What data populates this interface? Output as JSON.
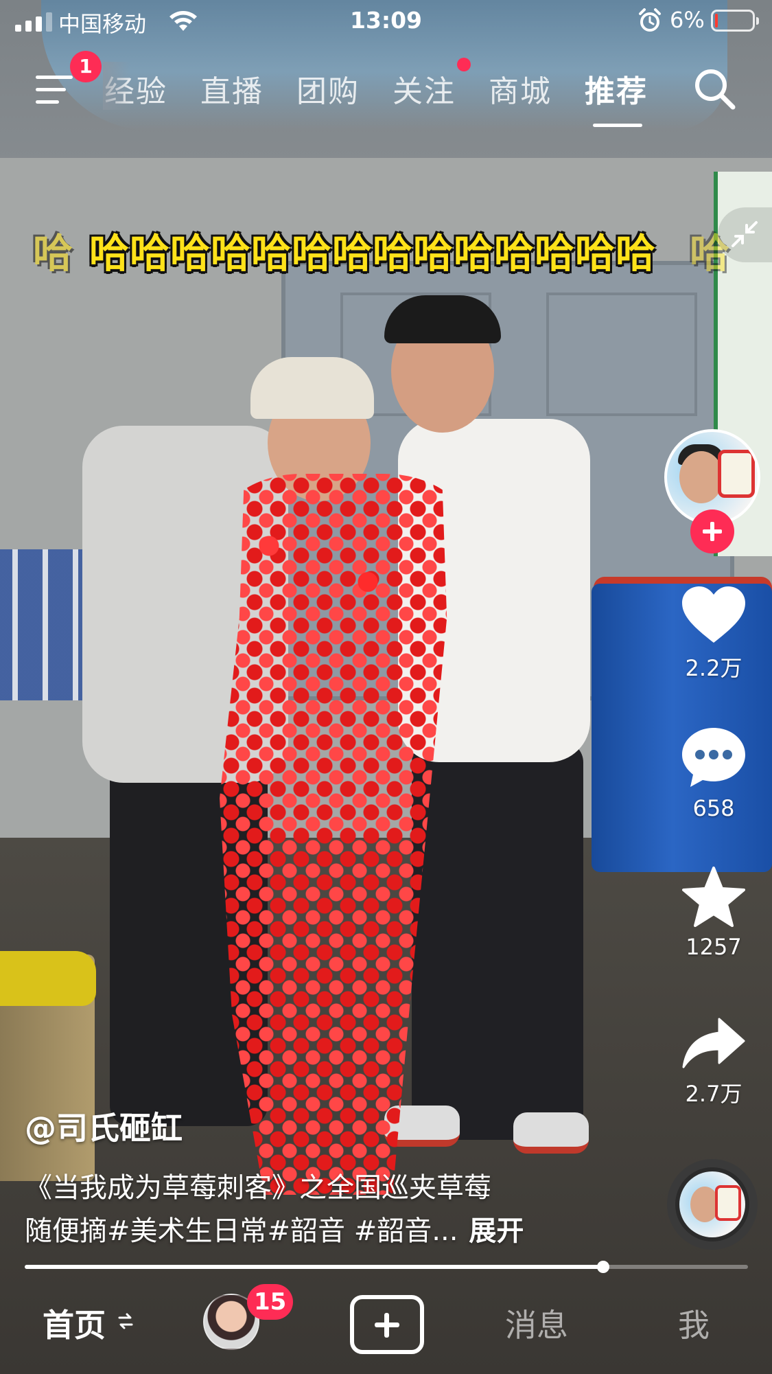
{
  "status_bar": {
    "carrier": "中国移动",
    "time": "13:09",
    "battery": "6%",
    "battery_level": 0.06,
    "icons": [
      "signal-icon",
      "wifi-icon",
      "alarm-icon",
      "battery-icon"
    ]
  },
  "top_nav": {
    "menu_badge": "1",
    "tabs": [
      {
        "label": "经验"
      },
      {
        "label": "直播"
      },
      {
        "label": "团购"
      },
      {
        "label": "关注",
        "has_dot": true
      },
      {
        "label": "商城"
      },
      {
        "label": "推荐",
        "active": true
      }
    ],
    "search_icon": "search-icon"
  },
  "video": {
    "overlay_text": "哈哈哈哈哈哈哈哈哈哈哈哈哈哈",
    "overlay_ghost_left": "哈",
    "overlay_ghost_right": "哈"
  },
  "actions": {
    "like_count": "2.2万",
    "comment_count": "658",
    "favorite_count": "1257",
    "share_count": "2.7万"
  },
  "post": {
    "author": "@司氏砸缸",
    "description_line1": "《当我成为草莓刺客》之全国巡夹草莓",
    "description_line2": "随便摘#美术生日常#韶音 #韶音...",
    "expand_label": "展开",
    "progress": 0.8
  },
  "bottom_bar": {
    "home": "首页",
    "friends_badge": "15",
    "messages": "消息",
    "me": "我"
  },
  "colors": {
    "accent": "#fe2c55",
    "overlay_text": "#ffe21a",
    "battery_low": "#ff3b30"
  }
}
